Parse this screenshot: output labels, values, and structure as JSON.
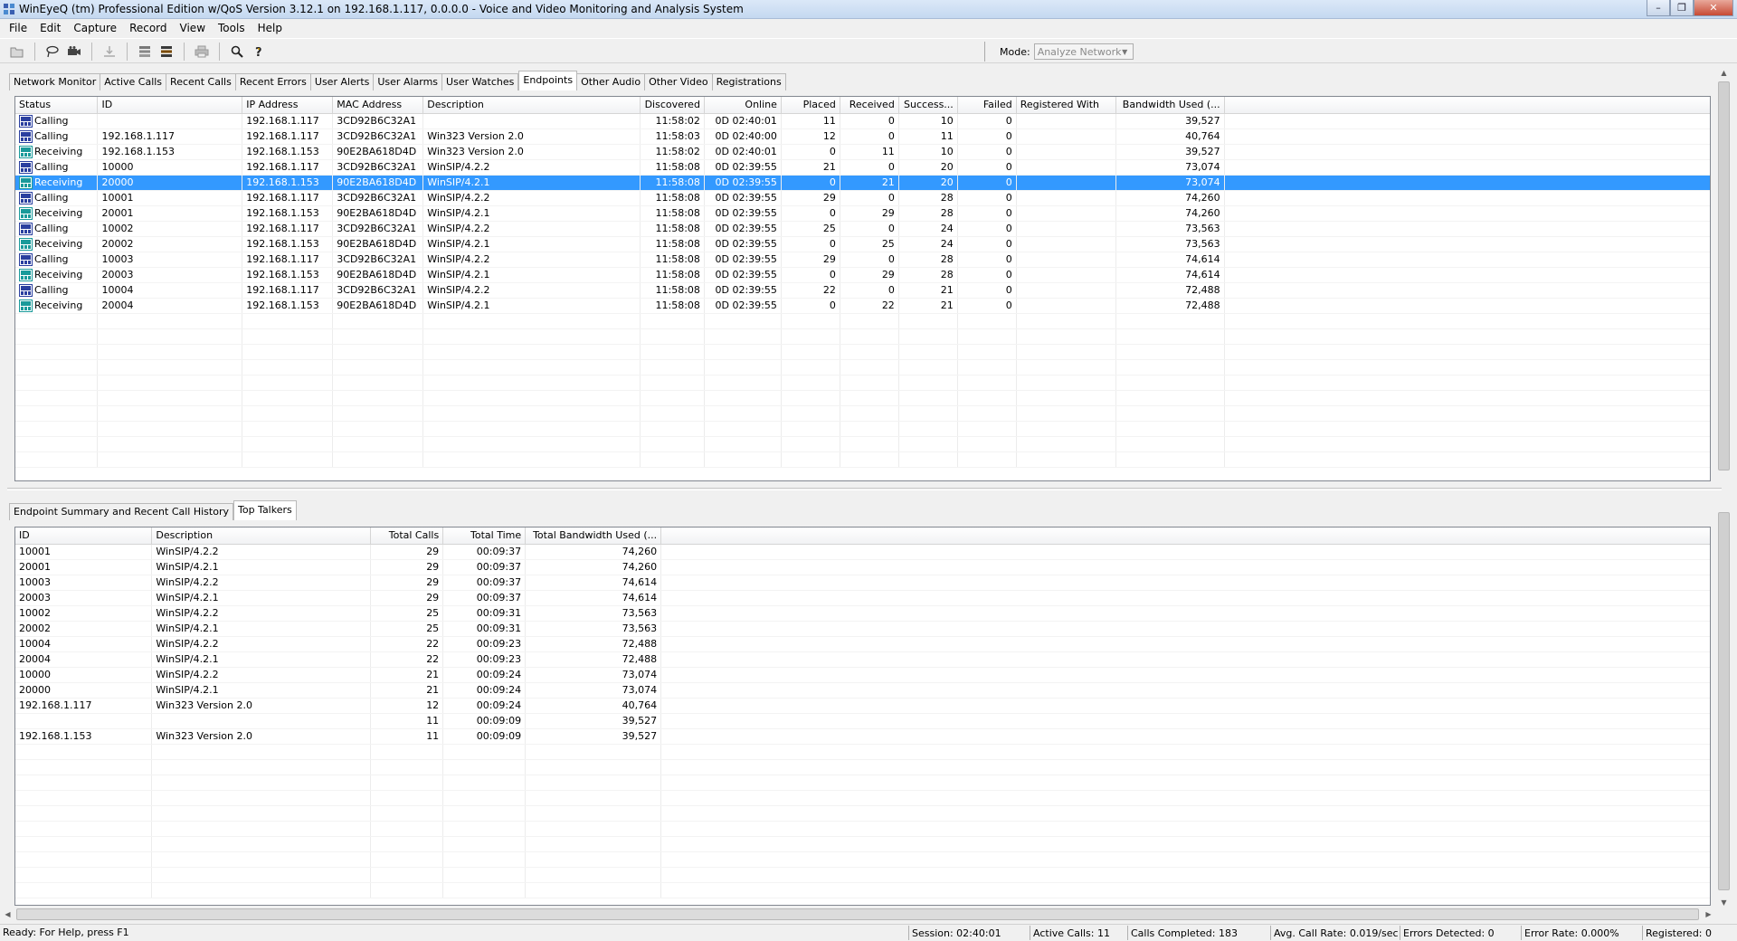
{
  "window": {
    "title": "WinEyeQ (tm) Professional Edition w/QoS Version 3.12.1 on 192.168.1.117, 0.0.0.0 - Voice and Video Monitoring and Analysis System",
    "minimize": "–",
    "maximize": "❐",
    "close": "✕"
  },
  "menu": [
    "File",
    "Edit",
    "Capture",
    "Record",
    "View",
    "Tools",
    "Help"
  ],
  "toolbar": {
    "icons": [
      "open-folder-icon",
      "lasso-icon",
      "camera-icon",
      "download-icon",
      "stack-icon",
      "stack-alt-icon",
      "print-icon",
      "magnifier-icon",
      "help-icon"
    ],
    "mode_label": "Mode:",
    "mode_value": "Analyze Network"
  },
  "top_tabs": [
    {
      "label": "Network Monitor",
      "active": false
    },
    {
      "label": "Active Calls",
      "active": false
    },
    {
      "label": "Recent Calls",
      "active": false
    },
    {
      "label": "Recent Errors",
      "active": false
    },
    {
      "label": "User Alerts",
      "active": false
    },
    {
      "label": "User Alarms",
      "active": false
    },
    {
      "label": "User Watches",
      "active": false
    },
    {
      "label": "Endpoints",
      "active": true
    },
    {
      "label": "Other Audio",
      "active": false
    },
    {
      "label": "Other Video",
      "active": false
    },
    {
      "label": "Registrations",
      "active": false
    }
  ],
  "endpoints": {
    "columns": [
      "Status",
      "ID",
      "IP Address",
      "MAC Address",
      "Description",
      "Discovered",
      "Online",
      "Placed",
      "Received",
      "Success...",
      "Failed",
      "Registered With",
      "Bandwidth Used (..."
    ],
    "rows": [
      [
        "Calling",
        "",
        "192.168.1.117",
        "3CD92B6C32A1",
        "",
        "11:58:02",
        "0D 02:40:01",
        "11",
        "0",
        "10",
        "0",
        "",
        "39,527"
      ],
      [
        "Calling",
        "192.168.1.117",
        "192.168.1.117",
        "3CD92B6C32A1",
        "Win323 Version 2.0",
        "11:58:03",
        "0D 02:40:00",
        "12",
        "0",
        "11",
        "0",
        "",
        "40,764"
      ],
      [
        "Receiving",
        "192.168.1.153",
        "192.168.1.153",
        "90E2BA618D4D",
        "Win323 Version 2.0",
        "11:58:02",
        "0D 02:40:01",
        "0",
        "11",
        "10",
        "0",
        "",
        "39,527"
      ],
      [
        "Calling",
        "10000",
        "192.168.1.117",
        "3CD92B6C32A1",
        "WinSIP/4.2.2",
        "11:58:08",
        "0D 02:39:55",
        "21",
        "0",
        "20",
        "0",
        "",
        "73,074"
      ],
      [
        "Receiving",
        "20000",
        "192.168.1.153",
        "90E2BA618D4D",
        "WinSIP/4.2.1",
        "11:58:08",
        "0D 02:39:55",
        "0",
        "21",
        "20",
        "0",
        "",
        "73,074"
      ],
      [
        "Calling",
        "10001",
        "192.168.1.117",
        "3CD92B6C32A1",
        "WinSIP/4.2.2",
        "11:58:08",
        "0D 02:39:55",
        "29",
        "0",
        "28",
        "0",
        "",
        "74,260"
      ],
      [
        "Receiving",
        "20001",
        "192.168.1.153",
        "90E2BA618D4D",
        "WinSIP/4.2.1",
        "11:58:08",
        "0D 02:39:55",
        "0",
        "29",
        "28",
        "0",
        "",
        "74,260"
      ],
      [
        "Calling",
        "10002",
        "192.168.1.117",
        "3CD92B6C32A1",
        "WinSIP/4.2.2",
        "11:58:08",
        "0D 02:39:55",
        "25",
        "0",
        "24",
        "0",
        "",
        "73,563"
      ],
      [
        "Receiving",
        "20002",
        "192.168.1.153",
        "90E2BA618D4D",
        "WinSIP/4.2.1",
        "11:58:08",
        "0D 02:39:55",
        "0",
        "25",
        "24",
        "0",
        "",
        "73,563"
      ],
      [
        "Calling",
        "10003",
        "192.168.1.117",
        "3CD92B6C32A1",
        "WinSIP/4.2.2",
        "11:58:08",
        "0D 02:39:55",
        "29",
        "0",
        "28",
        "0",
        "",
        "74,614"
      ],
      [
        "Receiving",
        "20003",
        "192.168.1.153",
        "90E2BA618D4D",
        "WinSIP/4.2.1",
        "11:58:08",
        "0D 02:39:55",
        "0",
        "29",
        "28",
        "0",
        "",
        "74,614"
      ],
      [
        "Calling",
        "10004",
        "192.168.1.117",
        "3CD92B6C32A1",
        "WinSIP/4.2.2",
        "11:58:08",
        "0D 02:39:55",
        "22",
        "0",
        "21",
        "0",
        "",
        "72,488"
      ],
      [
        "Receiving",
        "20004",
        "192.168.1.153",
        "90E2BA618D4D",
        "WinSIP/4.2.1",
        "11:58:08",
        "0D 02:39:55",
        "0",
        "22",
        "21",
        "0",
        "",
        "72,488"
      ]
    ],
    "selected_row": 4
  },
  "bottom_tabs": [
    {
      "label": "Endpoint Summary and Recent Call History",
      "active": false
    },
    {
      "label": "Top Talkers",
      "active": true
    }
  ],
  "top_talkers": {
    "columns": [
      "ID",
      "Description",
      "Total Calls",
      "Total Time",
      "Total Bandwidth Used (..."
    ],
    "rows": [
      [
        "10001",
        "WinSIP/4.2.2",
        "29",
        "00:09:37",
        "74,260"
      ],
      [
        "20001",
        "WinSIP/4.2.1",
        "29",
        "00:09:37",
        "74,260"
      ],
      [
        "10003",
        "WinSIP/4.2.2",
        "29",
        "00:09:37",
        "74,614"
      ],
      [
        "20003",
        "WinSIP/4.2.1",
        "29",
        "00:09:37",
        "74,614"
      ],
      [
        "10002",
        "WinSIP/4.2.2",
        "25",
        "00:09:31",
        "73,563"
      ],
      [
        "20002",
        "WinSIP/4.2.1",
        "25",
        "00:09:31",
        "73,563"
      ],
      [
        "10004",
        "WinSIP/4.2.2",
        "22",
        "00:09:23",
        "72,488"
      ],
      [
        "20004",
        "WinSIP/4.2.1",
        "22",
        "00:09:23",
        "72,488"
      ],
      [
        "10000",
        "WinSIP/4.2.2",
        "21",
        "00:09:24",
        "73,074"
      ],
      [
        "20000",
        "WinSIP/4.2.1",
        "21",
        "00:09:24",
        "73,074"
      ],
      [
        "192.168.1.117",
        "Win323 Version 2.0",
        "12",
        "00:09:24",
        "40,764"
      ],
      [
        "",
        "",
        "11",
        "00:09:09",
        "39,527"
      ],
      [
        "192.168.1.153",
        "Win323 Version 2.0",
        "11",
        "00:09:09",
        "39,527"
      ]
    ]
  },
  "statusbar": {
    "help": "Ready: For Help, press F1",
    "session": "Session: 02:40:01",
    "active_calls": "Active Calls: 11",
    "calls_completed": "Calls Completed: 183",
    "avg_call_rate": "Avg. Call Rate: 0.019/sec",
    "errors_detected": "Errors Detected: 0",
    "error_rate": "Error Rate: 0.000%",
    "registered": "Registered: 0"
  },
  "colors": {
    "selection": "#3399ff",
    "calling_icon": "#2a3f9f",
    "receiving_icon": "#1a9a9a"
  }
}
